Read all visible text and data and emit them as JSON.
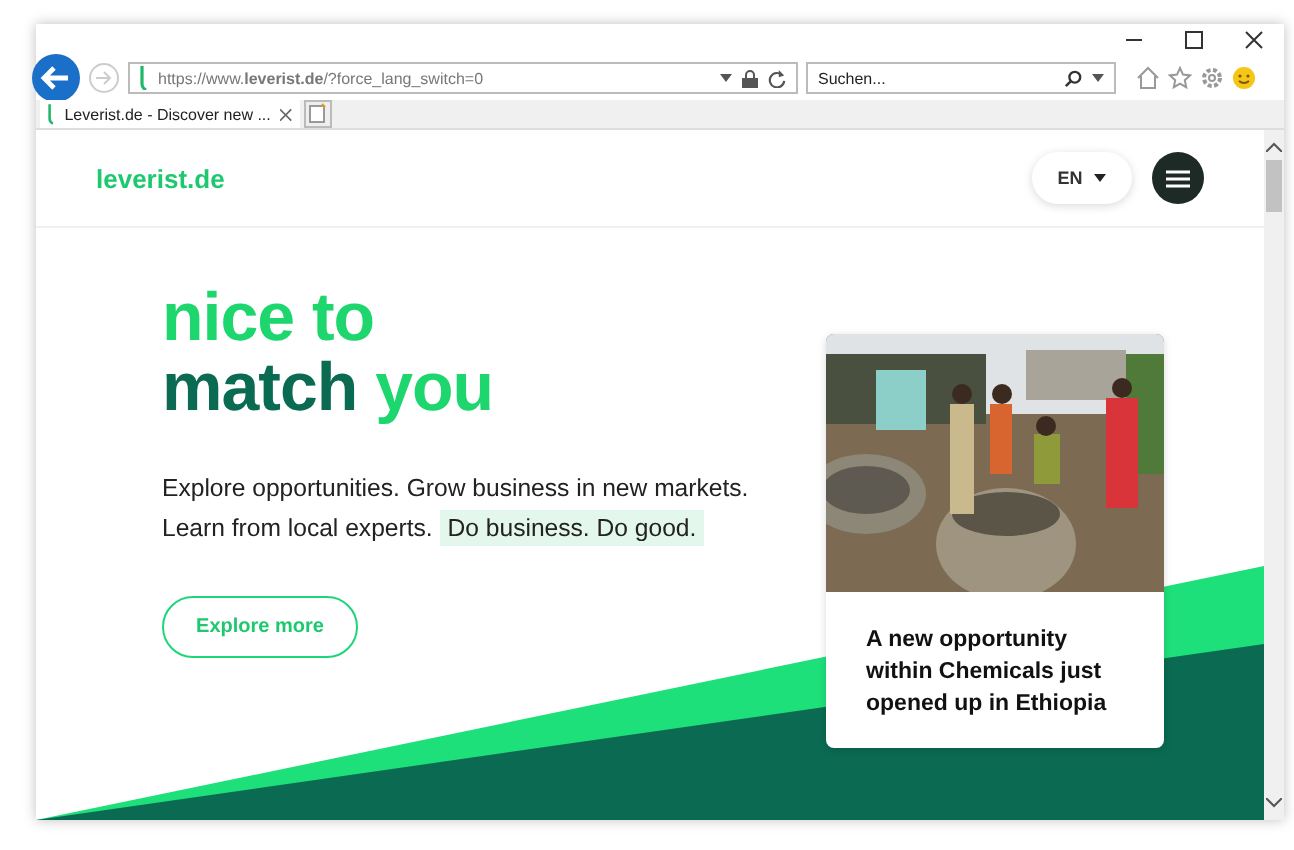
{
  "browser": {
    "url": "https://www.**leverist.de**/?force_lang_switch=0",
    "search": {
      "placeholder": "Suchen..."
    },
    "tab": {
      "label": "Leverist.de - Discover new ...",
      "selected": true
    }
  },
  "header": {
    "logo": "leverist.de",
    "language": "EN"
  },
  "hero": {
    "headline": [
      "nice to",
      "match *you*"
    ],
    "text": "Explore opportunities. Grow business in new markets. Learn from local experts. **Do business. Do good.**",
    "button": "Explore more"
  },
  "card": {
    "title": "A new opportunity within Chemicals just opened up in Ethiopia"
  }
}
